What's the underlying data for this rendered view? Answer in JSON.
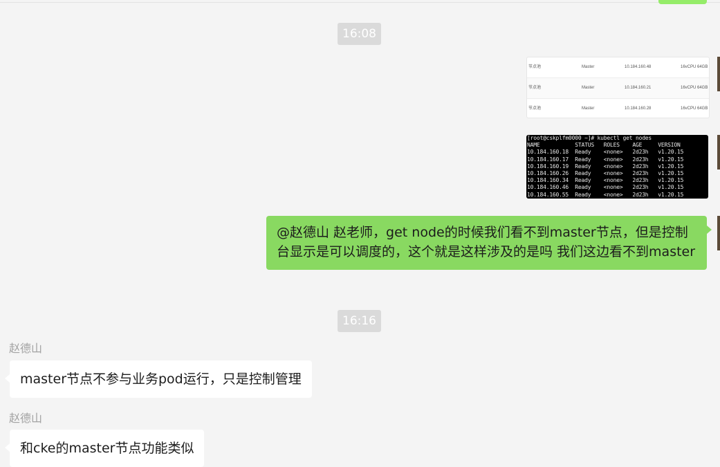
{
  "timestamps": [
    "16:08",
    "16:16"
  ],
  "table_image": {
    "rows": [
      {
        "name": "节点池",
        "role": "Master",
        "ip": "10.184.160.48",
        "spec": "16vCPU 64GB"
      },
      {
        "name": "节点池",
        "role": "Master",
        "ip": "10.184.160.21",
        "spec": "16vCPU 64GB"
      },
      {
        "name": "节点池",
        "role": "Master",
        "ip": "10.184.160.28",
        "spec": "16vCPU 64GB"
      }
    ]
  },
  "terminal_image": {
    "lines": [
      "[root@cskplfm0000 ~]# kubectl get nodes",
      "NAME           STATUS   ROLES    AGE     VERSION",
      "10.184.160.18  Ready    <none>   2d23h   v1.20.15",
      "10.184.160.17  Ready    <none>   2d23h   v1.20.15",
      "10.184.160.19  Ready    <none>   2d23h   v1.20.15",
      "10.184.160.26  Ready    <none>   2d23h   v1.20.15",
      "10.184.160.34  Ready    <none>   2d23h   v1.20.15",
      "10.184.160.46  Ready    <none>   2d23h   v1.20.15",
      "10.184.160.55  Ready    <none>   2d23h   v1.20.15"
    ]
  },
  "my_message": "@赵德山 赵老师，get node的时候我们看不到master节点，但是控制台显示是可以调度的，这个就是这样涉及的是吗   我们这边看不到master",
  "replies": [
    {
      "sender": "赵德山",
      "text": "master节点不参与业务pod运行，只是控制管理"
    },
    {
      "sender": "赵德山",
      "text": "和cke的master节点功能类似"
    }
  ],
  "colors": {
    "my_bubble": "#89d961",
    "other_bubble": "#ffffff",
    "background": "#f4f4f4"
  }
}
